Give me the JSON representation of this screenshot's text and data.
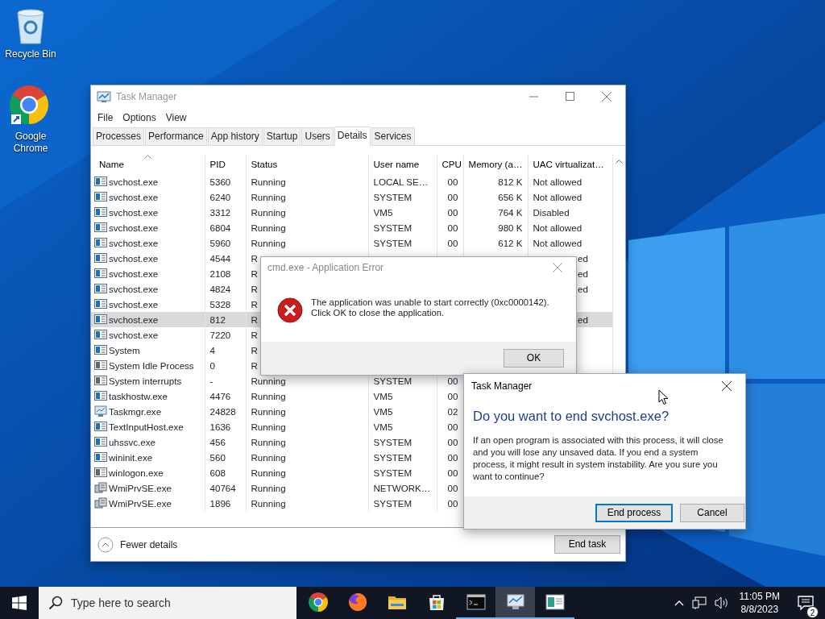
{
  "desktop_icons": [
    {
      "label": "Recycle Bin",
      "kind": "recycle"
    },
    {
      "label": "Google Chrome",
      "kind": "browser"
    }
  ],
  "task_manager": {
    "title": "Task Manager",
    "menu": [
      "File",
      "Options",
      "View"
    ],
    "tabs": [
      {
        "label": "Processes",
        "selected": false
      },
      {
        "label": "Performance",
        "selected": false
      },
      {
        "label": "App history",
        "selected": false
      },
      {
        "label": "Startup",
        "selected": false
      },
      {
        "label": "Users",
        "selected": false
      },
      {
        "label": "Details",
        "selected": true
      },
      {
        "label": "Services",
        "selected": false
      }
    ],
    "columns": [
      {
        "label": "Name",
        "sorted": true
      },
      {
        "label": "PID",
        "sorted": false
      },
      {
        "label": "Status",
        "sorted": false
      },
      {
        "label": "User name",
        "sorted": false
      },
      {
        "label": "CPU",
        "sorted": false
      },
      {
        "label": "Memory (a…",
        "sorted": false
      },
      {
        "label": "UAC virtualizat…",
        "sorted": false
      }
    ],
    "rows": [
      {
        "kind": "service",
        "name": "svchost.exe",
        "pid": "5360",
        "status": "Running",
        "user": "LOCAL SE…",
        "cpu": "00",
        "memory": "812 K",
        "uac": "Not allowed",
        "selected": false
      },
      {
        "kind": "service",
        "name": "svchost.exe",
        "pid": "6240",
        "status": "Running",
        "user": "SYSTEM",
        "cpu": "00",
        "memory": "656 K",
        "uac": "Not allowed",
        "selected": false
      },
      {
        "kind": "service",
        "name": "svchost.exe",
        "pid": "3312",
        "status": "Running",
        "user": "VM5",
        "cpu": "00",
        "memory": "764 K",
        "uac": "Disabled",
        "selected": false
      },
      {
        "kind": "service",
        "name": "svchost.exe",
        "pid": "6804",
        "status": "Running",
        "user": "SYSTEM",
        "cpu": "00",
        "memory": "980 K",
        "uac": "Not allowed",
        "selected": false
      },
      {
        "kind": "service",
        "name": "svchost.exe",
        "pid": "5960",
        "status": "Running",
        "user": "SYSTEM",
        "cpu": "00",
        "memory": "612 K",
        "uac": "Not allowed",
        "selected": false
      },
      {
        "kind": "service",
        "name": "svchost.exe",
        "pid": "4544",
        "status": "R",
        "uac": "ed",
        "uac_cut": true,
        "selected": false
      },
      {
        "kind": "service",
        "name": "svchost.exe",
        "pid": "2108",
        "status": "R",
        "uac": "ed",
        "uac_cut": true,
        "selected": false
      },
      {
        "kind": "service",
        "name": "svchost.exe",
        "pid": "4824",
        "status": "R",
        "uac": "ed",
        "uac_cut": true,
        "selected": false
      },
      {
        "kind": "service",
        "name": "svchost.exe",
        "pid": "5328",
        "status": "R",
        "selected": false
      },
      {
        "kind": "service",
        "name": "svchost.exe",
        "pid": "812",
        "status": "R",
        "uac": "ed",
        "uac_cut": true,
        "selected": true
      },
      {
        "kind": "service",
        "name": "svchost.exe",
        "pid": "7220",
        "status": "R",
        "selected": false
      },
      {
        "kind": "service",
        "name": "System",
        "pid": "4",
        "status": "R",
        "selected": false
      },
      {
        "kind": "system",
        "name": "System Idle Process",
        "pid": "0",
        "status": "R",
        "selected": false
      },
      {
        "kind": "system",
        "name": "System interrupts",
        "pid": "-",
        "status": "Running",
        "user": "SYSTEM",
        "cpu": "00",
        "selected": false
      },
      {
        "kind": "service",
        "name": "taskhostw.exe",
        "pid": "4476",
        "status": "Running",
        "user": "VM5",
        "cpu": "00",
        "selected": false
      },
      {
        "kind": "taskmgr",
        "name": "Taskmgr.exe",
        "pid": "24828",
        "status": "Running",
        "user": "VM5",
        "cpu": "02",
        "selected": false
      },
      {
        "kind": "service",
        "name": "TextInputHost.exe",
        "pid": "1636",
        "status": "Running",
        "user": "VM5",
        "cpu": "00",
        "selected": false
      },
      {
        "kind": "service",
        "name": "uhssvc.exe",
        "pid": "456",
        "status": "Running",
        "user": "SYSTEM",
        "cpu": "00",
        "selected": false
      },
      {
        "kind": "service",
        "name": "wininit.exe",
        "pid": "560",
        "status": "Running",
        "user": "SYSTEM",
        "cpu": "00",
        "selected": false
      },
      {
        "kind": "system",
        "name": "winlogon.exe",
        "pid": "608",
        "status": "Running",
        "user": "SYSTEM",
        "cpu": "00",
        "selected": false
      },
      {
        "kind": "wmi",
        "name": "WmiPrvSE.exe",
        "pid": "40764",
        "status": "Running",
        "user": "NETWORK…",
        "cpu": "00",
        "selected": false
      },
      {
        "kind": "wmi",
        "name": "WmiPrvSE.exe",
        "pid": "1896",
        "status": "Running",
        "user": "SYSTEM",
        "cpu": "00",
        "selected": false
      }
    ],
    "fewer_details": "Fewer details",
    "end_task": "End task"
  },
  "error_dialog": {
    "title": "cmd.exe - Application Error",
    "message": "The application was unable to start correctly (0xc0000142).\nClick OK to close the application.",
    "button": "OK"
  },
  "confirm_dialog": {
    "title": "Task Manager",
    "heading": "Do you want to end svchost.exe?",
    "message": "If an open program is associated with this process, it will close and you will lose any unsaved data. If you end a system process, it might result in system instability. Are you sure you want to continue?",
    "buttons": [
      {
        "label": "End process",
        "default": true
      },
      {
        "label": "Cancel",
        "default": false
      }
    ]
  },
  "taskbar": {
    "search_placeholder": "Type here to search",
    "apps": [
      {
        "kind": "browser",
        "running": false,
        "active": false
      },
      {
        "kind": "firefox",
        "running": false,
        "active": false
      },
      {
        "kind": "folder",
        "running": false,
        "active": false
      },
      {
        "kind": "store",
        "running": false,
        "active": false
      },
      {
        "kind": "terminal",
        "running": true,
        "active": false
      },
      {
        "kind": "taskmgr",
        "running": true,
        "active": true
      },
      {
        "kind": "window",
        "running": true,
        "active": false
      }
    ],
    "time": "11:05 PM",
    "date": "8/8/2023",
    "notification_count": "2"
  }
}
